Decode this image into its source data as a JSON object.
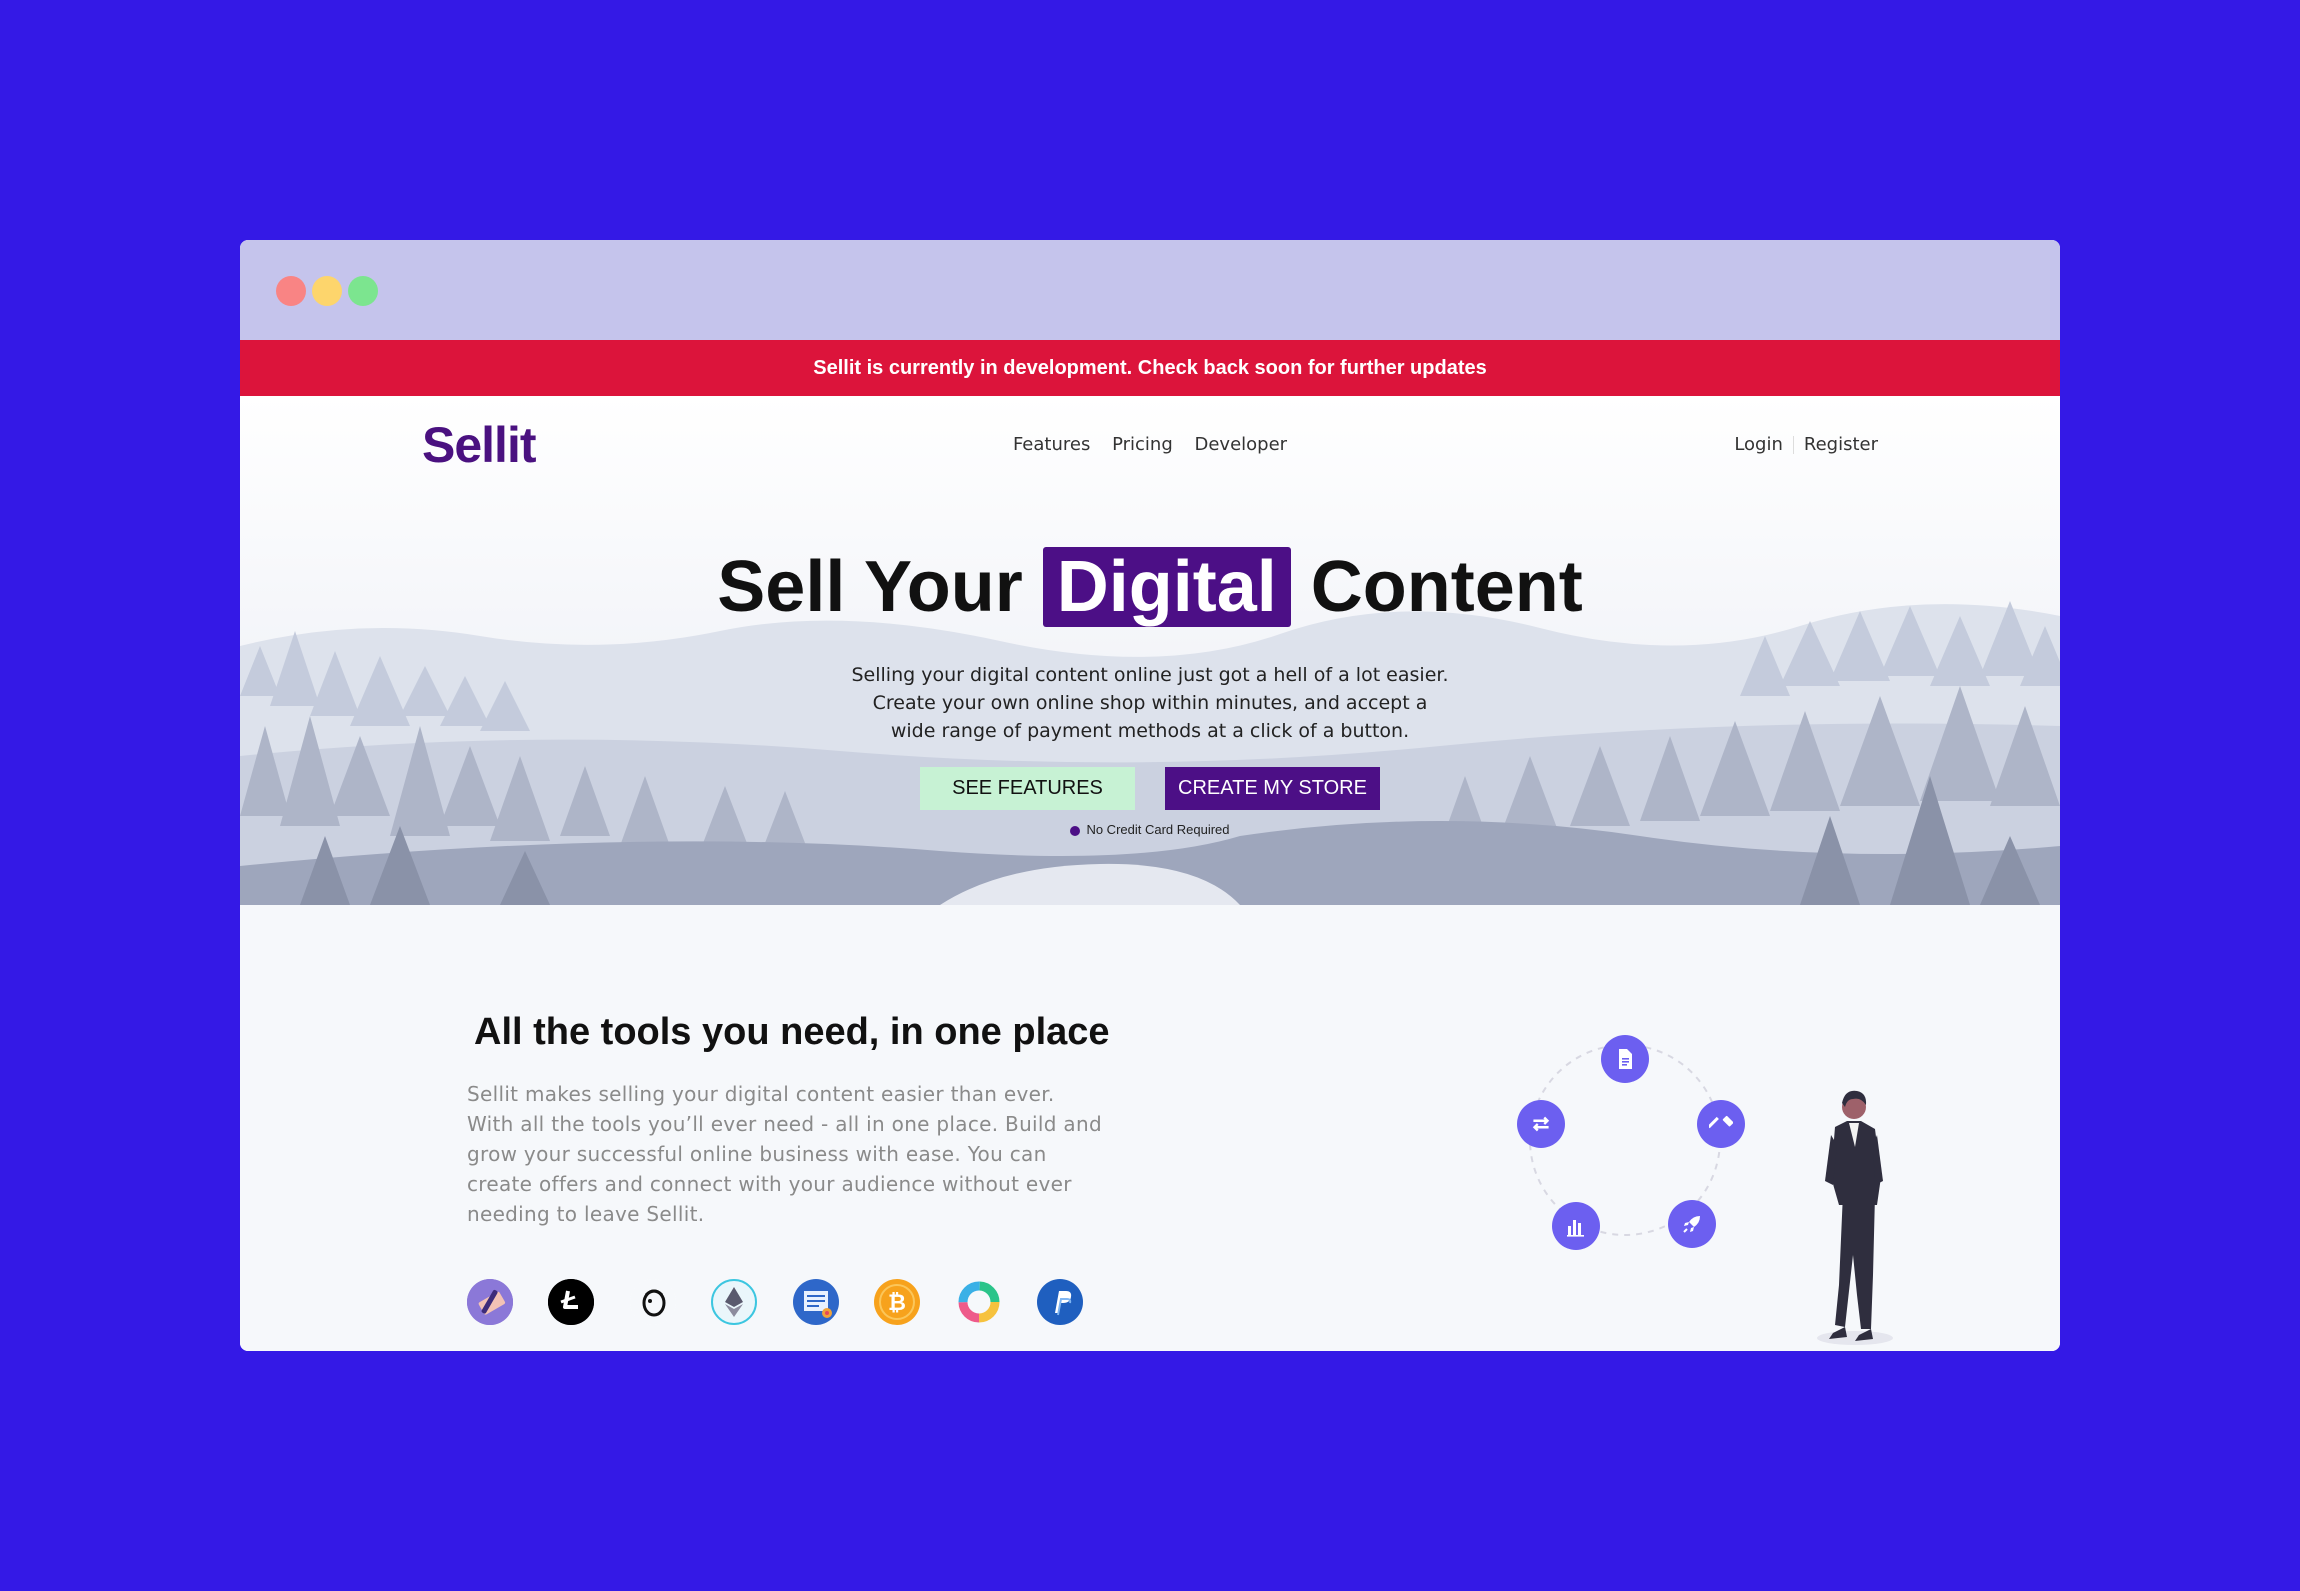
{
  "banner": {
    "text": "Sellit is currently in development. Check back soon for further updates"
  },
  "brand": {
    "name": "Sellit",
    "accent": "#4c0f86",
    "banner_color": "#dc143b",
    "page_bg": "#3419e6"
  },
  "nav": {
    "items": [
      {
        "label": "Features"
      },
      {
        "label": "Pricing"
      },
      {
        "label": "Developer"
      }
    ],
    "login": "Login",
    "register": "Register"
  },
  "hero": {
    "headline_before": "Sell Your",
    "headline_highlight": "Digital",
    "headline_after": "Content",
    "subtext": "Selling your digital content online just got a hell of a lot easier. Create your own online shop within minutes, and accept a wide range of payment methods at a click of a button.",
    "primary_button": "SEE FEATURES",
    "secondary_button": "CREATE MY STORE",
    "note": "No Credit Card Required"
  },
  "tools": {
    "title": "All the tools you need, in one place",
    "body": "Sellit makes selling your digital content easier than ever. With all the tools you’ll ever need - all in one place. Build and grow your successful online business with ease. You can create offers and connect with your audience without ever needing to leave Sellit.",
    "integrations": [
      "stripe-icon",
      "litecoin-icon",
      "mailchimp-icon",
      "ethereum-icon",
      "certificate-icon",
      "bitcoin-icon",
      "donut-icon",
      "paypal-icon"
    ],
    "orbit_icons": [
      "document-icon",
      "hammer-icon",
      "rocket-icon",
      "bar-chart-icon",
      "swap-icon"
    ]
  }
}
